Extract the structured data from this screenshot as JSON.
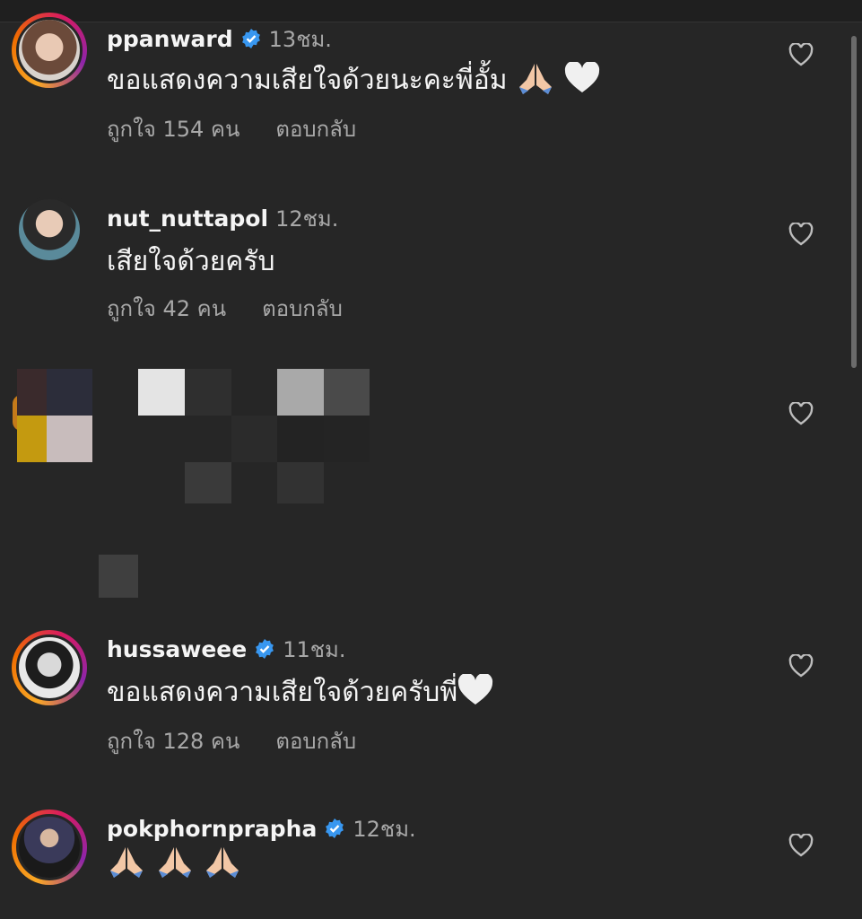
{
  "comments": [
    {
      "username": "ppanward",
      "verified": true,
      "time": "13ชม.",
      "text": "ขอแสดงความเสียใจด้วยนะคะพี่อั้ม ",
      "likes": "ถูกใจ 154 คน",
      "reply": "ตอบกลับ"
    },
    {
      "username": "nut_nuttapol",
      "verified": false,
      "time": "12ชม.",
      "text": "เสียใจด้วยครับ",
      "likes": "ถูกใจ 42 คน",
      "reply": "ตอบกลับ"
    },
    {
      "username": "hussaweee",
      "verified": true,
      "time": "11ชม.",
      "text": "ขอแสดงความเสียใจด้วยครับพี่",
      "likes": "ถูกใจ 128 คน",
      "reply": "ตอบกลับ"
    },
    {
      "username": "pokphornprapha",
      "verified": true,
      "time": "12ชม.",
      "text": "",
      "likes": "",
      "reply": ""
    }
  ],
  "icons": {
    "like": "heart-outline-icon",
    "verified": "verified-badge-icon",
    "pray": "folded-hands-emoji",
    "white_heart": "white-heart-emoji"
  },
  "colors": {
    "background": "#262626",
    "verified_blue": "#3897f0",
    "secondary_text": "#a8a8a8"
  }
}
